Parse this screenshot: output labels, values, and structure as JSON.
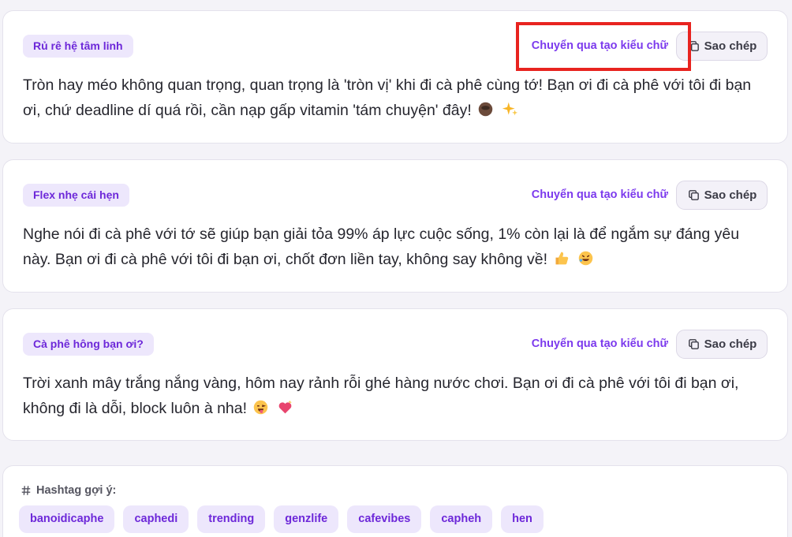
{
  "cards": [
    {
      "tag": "Rủ rê hệ tâm linh",
      "convert_label": "Chuyển qua tạo kiểu chữ",
      "copy_label": "Sao chép",
      "text": "Tròn hay méo không quan trọng, quan trọng là 'tròn vị' khi đi cà phê cùng tớ! Bạn ơi đi cà phê với tôi đi bạn ơi, chứ deadline dí quá rồi, cần nạp gấp vitamin 'tám chuyện' đây!",
      "emojis": [
        "coffee-emoji",
        "sparkles-emoji"
      ]
    },
    {
      "tag": "Flex nhẹ cái hẹn",
      "convert_label": "Chuyển qua tạo kiểu chữ",
      "copy_label": "Sao chép",
      "text": "Nghe nói đi cà phê với tớ sẽ giúp bạn giải tỏa 99% áp lực cuộc sống, 1% còn lại là để ngắm sự đáng yêu này. Bạn ơi đi cà phê với tôi đi bạn ơi, chốt đơn liền tay, không say không về!",
      "emojis": [
        "thumbs-up-emoji",
        "rolling-laughing-emoji"
      ]
    },
    {
      "tag": "Cà phê hông bạn ơi?",
      "convert_label": "Chuyển qua tạo kiểu chữ",
      "copy_label": "Sao chép",
      "text": "Trời xanh mây trắng nắng vàng, hôm nay rảnh rỗi ghé hàng nước chơi. Bạn ơi đi cà phê với tôi đi bạn ơi, không đi là dỗi, block luôn à nha!",
      "emojis": [
        "winking-tongue-emoji",
        "sparkling-heart-emoji"
      ]
    }
  ],
  "hashtags": {
    "heading": "Hashtag gợi ý:",
    "items": [
      "banoidicaphe",
      "caphedi",
      "trending",
      "genzlife",
      "cafevibes",
      "capheh",
      "hen"
    ]
  },
  "colors": {
    "accent": "#7c3aed",
    "tag_bg": "#ede7fc",
    "highlight": "#e8231f"
  }
}
